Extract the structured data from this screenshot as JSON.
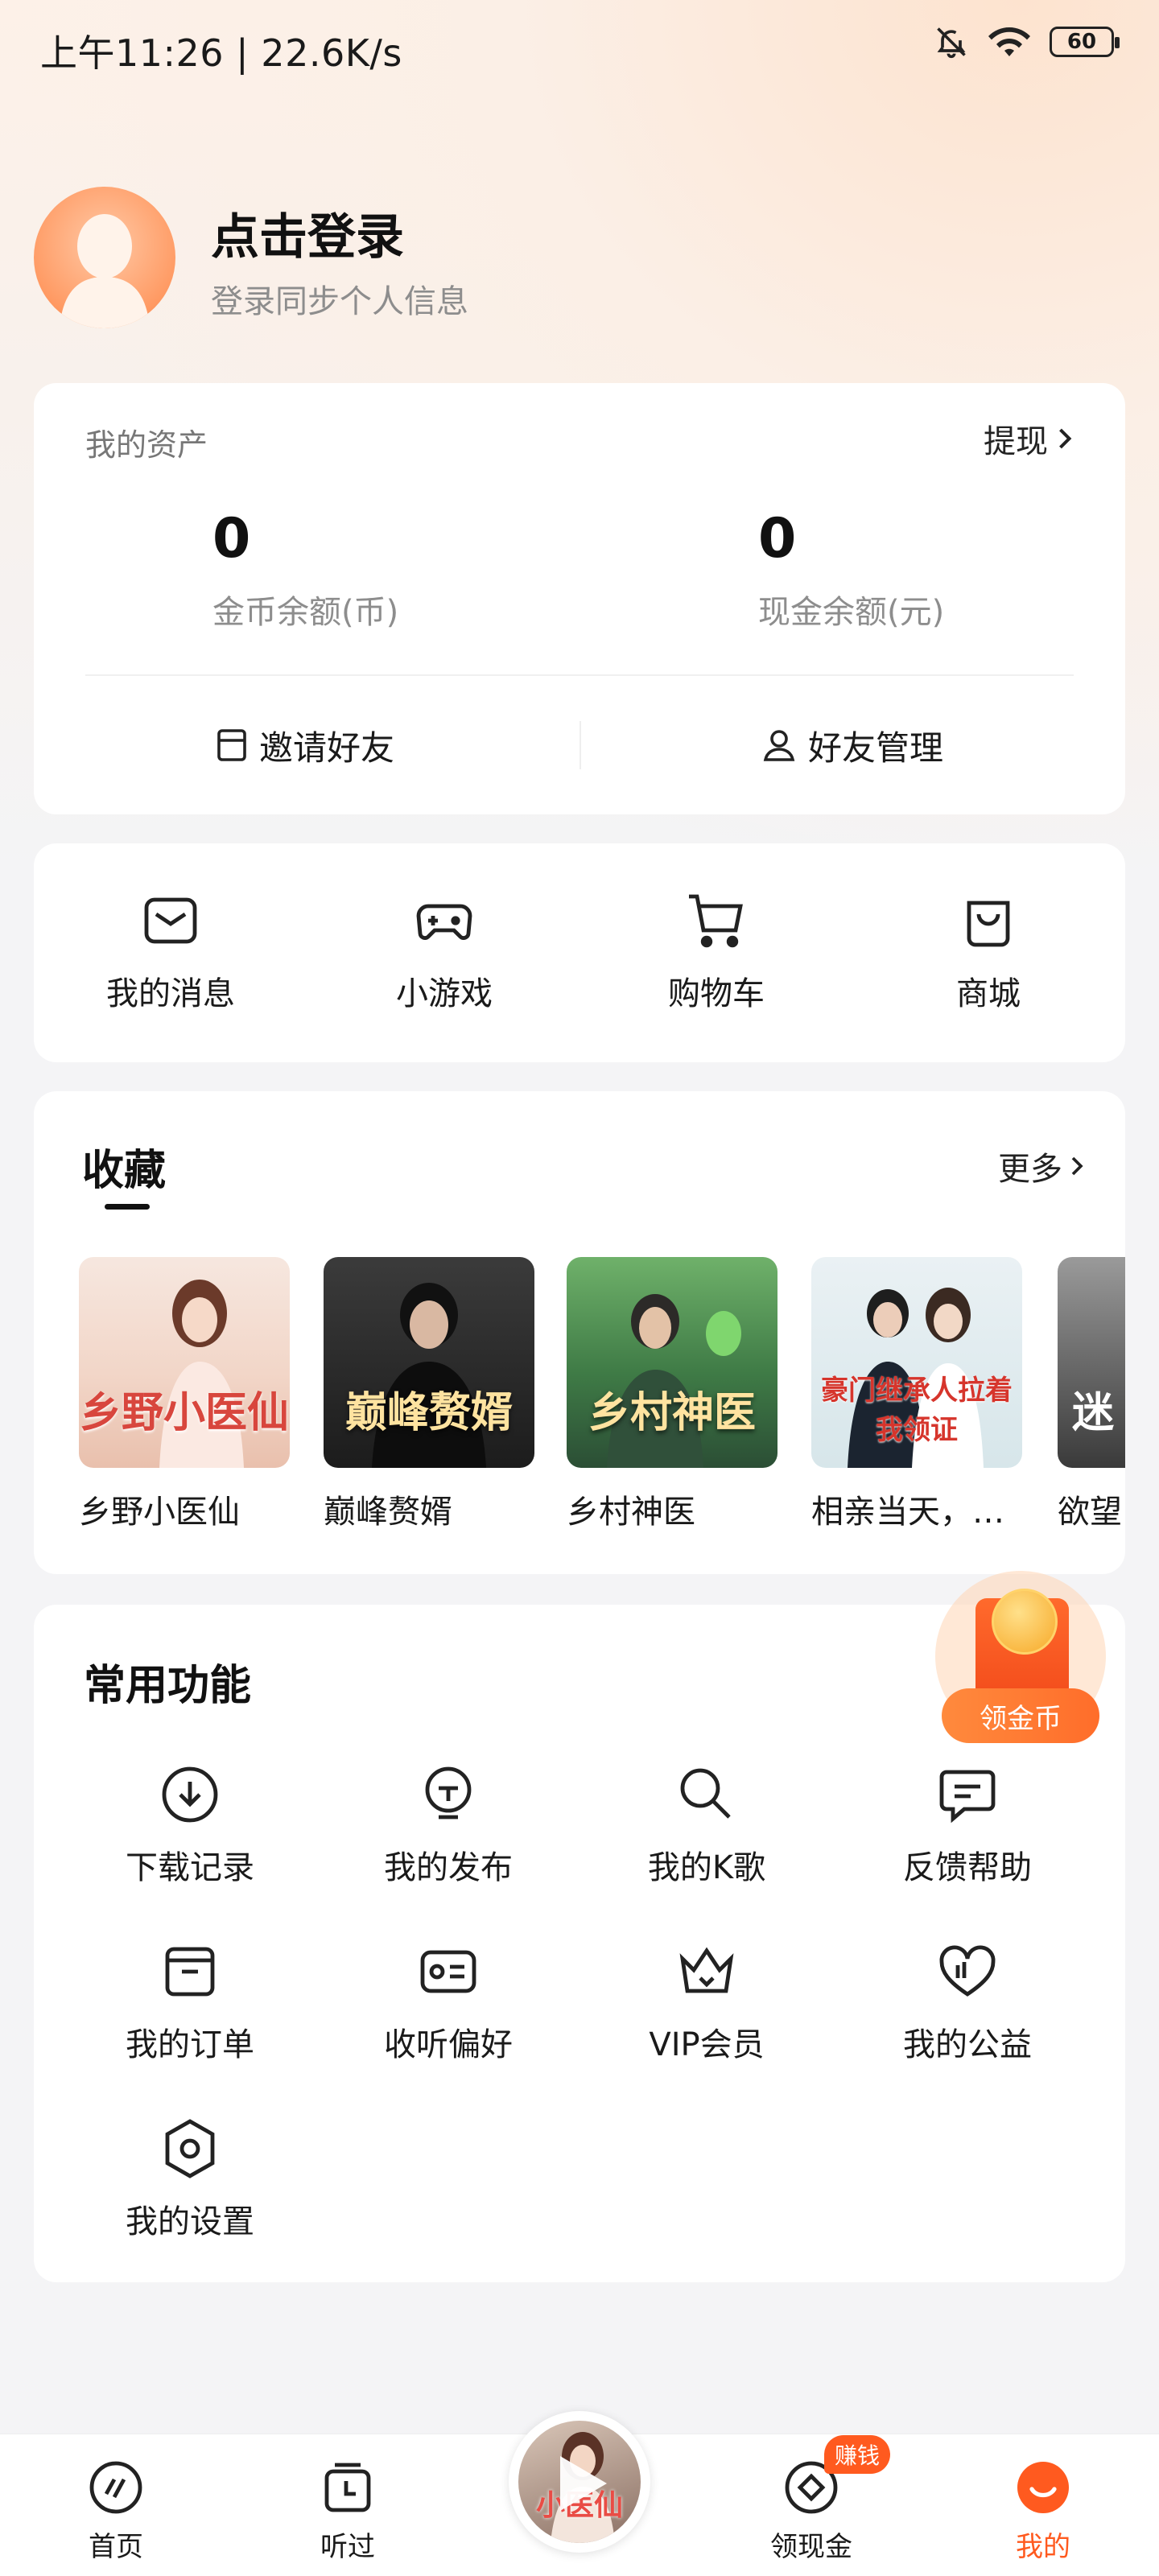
{
  "status_bar": {
    "time": "上午11:26 | 22.6K/s",
    "battery": "60"
  },
  "profile": {
    "title": "点击登录",
    "subtitle": "登录同步个人信息"
  },
  "assets": {
    "title": "我的资产",
    "withdraw_label": "提现",
    "coin_value": "0",
    "coin_label": "金币余额(币)",
    "cash_value": "0",
    "cash_label": "现金余额(元)",
    "invite_label": "邀请好友",
    "friends_label": "好友管理"
  },
  "quick": [
    {
      "label": "我的消息",
      "icon": "mail-icon"
    },
    {
      "label": "小游戏",
      "icon": "gamepad-icon"
    },
    {
      "label": "购物车",
      "icon": "cart-icon"
    },
    {
      "label": "商城",
      "icon": "bag-icon"
    }
  ],
  "favorites": {
    "title": "收藏",
    "more_label": "更多",
    "books": [
      {
        "title": "乡野小医仙",
        "cover_text": "乡野小医仙"
      },
      {
        "title": "巅峰赘婿",
        "cover_text": "巅峰赘婿"
      },
      {
        "title": "乡村神医",
        "cover_text": "乡村神医"
      },
      {
        "title": "相亲当天，…",
        "cover_text": "豪门继承人拉着我领证"
      },
      {
        "title": "欲望",
        "cover_text": "迷"
      }
    ]
  },
  "functions": {
    "title": "常用功能",
    "items": [
      {
        "label": "下载记录",
        "icon": "download-icon"
      },
      {
        "label": "我的发布",
        "icon": "publish-icon"
      },
      {
        "label": "我的K歌",
        "icon": "microphone-icon"
      },
      {
        "label": "反馈帮助",
        "icon": "feedback-icon"
      },
      {
        "label": "我的订单",
        "icon": "order-icon"
      },
      {
        "label": "收听偏好",
        "icon": "preference-icon"
      },
      {
        "label": "VIP会员",
        "icon": "crown-icon"
      },
      {
        "label": "我的公益",
        "icon": "charity-icon"
      },
      {
        "label": "我的设置",
        "icon": "settings-icon"
      }
    ]
  },
  "coin_float": {
    "label": "领金币"
  },
  "tabbar": {
    "tabs": [
      {
        "label": "首页",
        "icon": "home-icon"
      },
      {
        "label": "听过",
        "icon": "history-icon"
      },
      {
        "label": "领现金",
        "icon": "cash-icon"
      },
      {
        "label": "我的",
        "icon": "me-icon"
      }
    ],
    "earn_badge": "赚钱",
    "player_caption": "小医仙"
  },
  "colors": {
    "accent": "#ff5a1f",
    "card": "#ffffff",
    "background": "#f4f4f6"
  }
}
